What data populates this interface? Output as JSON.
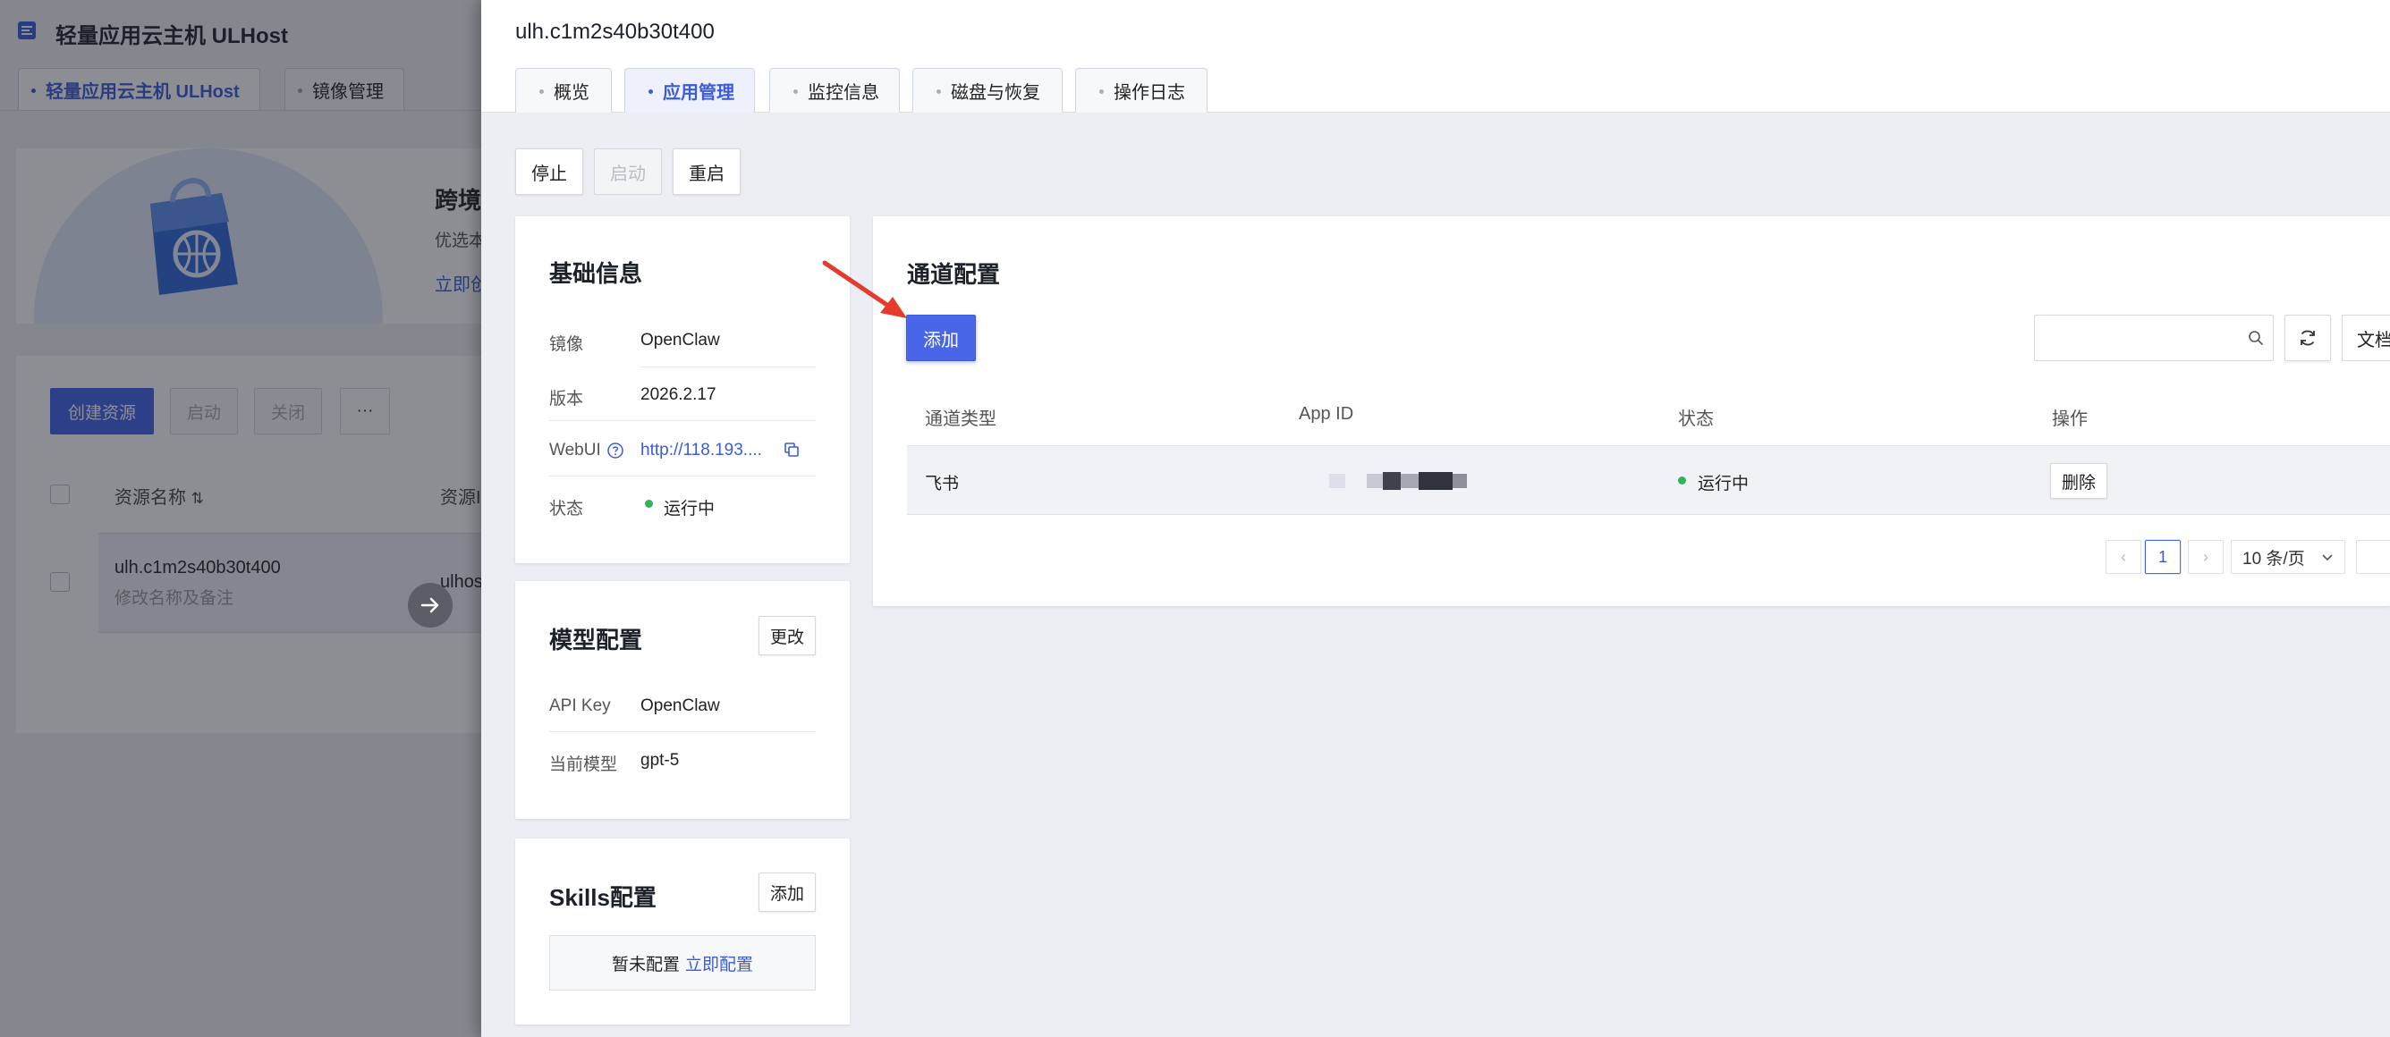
{
  "background_console": {
    "app_title": "轻量应用云主机 ULHost",
    "tabs": [
      {
        "label": "轻量应用云主机 ULHost",
        "active": true
      },
      {
        "label": "镜像管理",
        "active": false
      }
    ],
    "banner": {
      "title": "跨境",
      "desc": "优选本",
      "link": "立即创"
    },
    "toolbar": {
      "create": "创建资源",
      "start": "启动",
      "stop": "关闭",
      "more": "···"
    },
    "table": {
      "col_name": "资源名称",
      "col_sort_icon": "⇅",
      "col_other": "资源I"
    },
    "row": {
      "name": "ulh.c1m2s40b30t400",
      "sub": "修改名称及备注",
      "value": "ulhos"
    }
  },
  "drawer": {
    "title": "ulh.c1m2s40b30t400",
    "tabs": [
      {
        "label": "概览",
        "active": false
      },
      {
        "label": "应用管理",
        "active": true
      },
      {
        "label": "监控信息",
        "active": false
      },
      {
        "label": "磁盘与恢复",
        "active": false
      },
      {
        "label": "操作日志",
        "active": false
      }
    ],
    "actions": {
      "stop": "停止",
      "start": "启动",
      "restart": "重启"
    },
    "basic_info": {
      "title": "基础信息",
      "image_label": "镜像",
      "image_value": "OpenClaw",
      "version_label": "版本",
      "version_value": "2026.2.17",
      "webui_label": "WebUI",
      "webui_value": "http://118.193....",
      "status_label": "状态",
      "status_value": "运行中"
    },
    "model_config": {
      "title": "模型配置",
      "edit_button": "更改",
      "apikey_label": "API Key",
      "apikey_value": "OpenClaw",
      "model_label": "当前模型",
      "model_value": "gpt-5"
    },
    "skills_config": {
      "title": "Skills配置",
      "add_button": "添加",
      "empty_text": "暂未配置",
      "empty_link": "立即配置"
    },
    "channel_config": {
      "title": "通道配置",
      "add_button": "添加",
      "search_placeholder": "",
      "docs_button": "文档",
      "columns": [
        "通道类型",
        "App ID",
        "状态",
        "操作"
      ],
      "rows": [
        {
          "type": "飞书",
          "app_id": "",
          "status": "运行中",
          "action": "删除"
        }
      ],
      "pagination": {
        "prev": "‹",
        "current": "1",
        "next": "›",
        "page_size": "10 条/页"
      }
    }
  },
  "colors": {
    "primary": "#4a66e8",
    "link": "#3b5bdb",
    "status_running": "#2fb457",
    "annotation_arrow": "#e53b2c"
  }
}
